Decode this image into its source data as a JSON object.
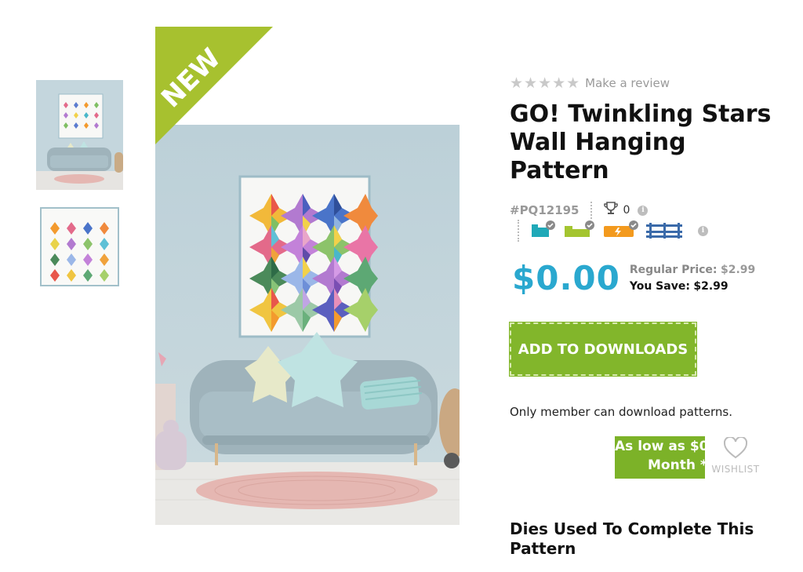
{
  "product": {
    "badge": "NEW",
    "review_link": "Make a review",
    "rating_stars": 0,
    "title": "GO! Twinkling Stars Wall Hanging Pattern",
    "sku": "#PQ12195",
    "trophy_count": "0"
  },
  "machines": {
    "icons": [
      "teal-machine-icon",
      "lime-machine-icon",
      "orange-machine-icon",
      "blue-machine-icon"
    ]
  },
  "pricing": {
    "price": "$0.00",
    "regular_label": "Regular Price:",
    "regular_value": "$2.99",
    "save_label": "You Save:",
    "save_value": "$2.99"
  },
  "actions": {
    "add_to_downloads": "ADD TO DOWNLOADS",
    "member_note": "Only member can download patterns.",
    "as_low_line1": "As low as $0",
    "as_low_line2": "Month *",
    "wishlist": "WISHLIST"
  },
  "sections": {
    "dies_heading": "Dies Used To Complete This Pattern"
  },
  "colors": {
    "accent_green": "#82b62b",
    "price_blue": "#2aa8cf",
    "badge_green": "#a7c12f"
  }
}
